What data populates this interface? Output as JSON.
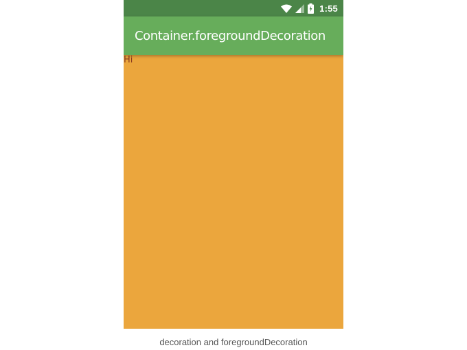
{
  "status_bar": {
    "time": "1:55",
    "icons": [
      "wifi-icon",
      "cellular-signal-icon",
      "battery-charging-icon"
    ],
    "color": "#4b8548"
  },
  "app_bar": {
    "title": "Container.foregroundDecoration",
    "color": "#67ad5b"
  },
  "body": {
    "text": "Hi",
    "background": "#eba63d",
    "text_color": "#8a3b1f"
  },
  "caption": "decoration and foregroundDecoration"
}
